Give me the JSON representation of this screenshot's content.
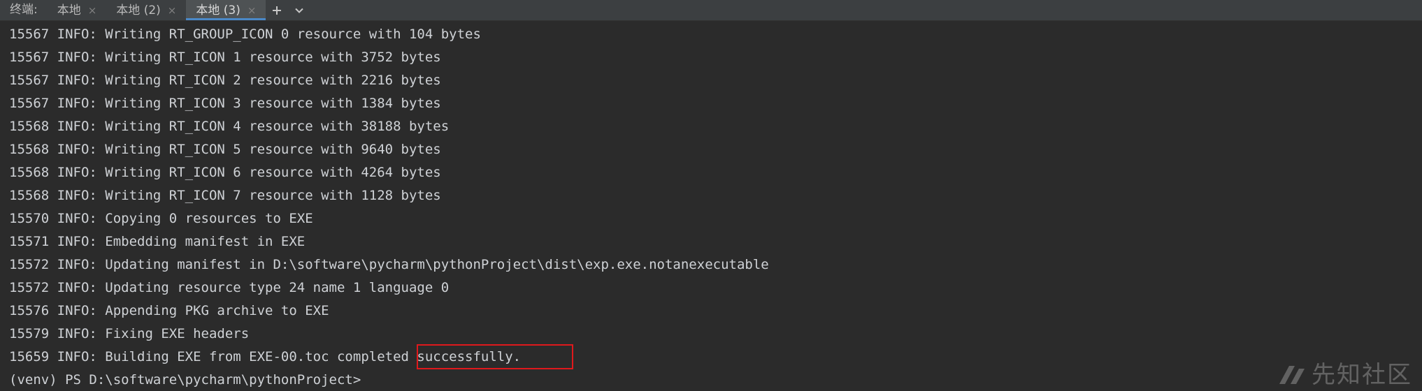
{
  "tabbar": {
    "caption": "终端:",
    "tabs": [
      {
        "label": "本地",
        "close": "×",
        "active": false
      },
      {
        "label": "本地 (2)",
        "close": "×",
        "active": false
      },
      {
        "label": "本地 (3)",
        "close": "×",
        "active": true
      }
    ],
    "add_icon": "plus-icon",
    "more_icon": "chevron-down-icon"
  },
  "terminal": {
    "lines": [
      "15567 INFO: Writing RT_GROUP_ICON 0 resource with 104 bytes",
      "15567 INFO: Writing RT_ICON 1 resource with 3752 bytes",
      "15567 INFO: Writing RT_ICON 2 resource with 2216 bytes",
      "15567 INFO: Writing RT_ICON 3 resource with 1384 bytes",
      "15568 INFO: Writing RT_ICON 4 resource with 38188 bytes",
      "15568 INFO: Writing RT_ICON 5 resource with 9640 bytes",
      "15568 INFO: Writing RT_ICON 6 resource with 4264 bytes",
      "15568 INFO: Writing RT_ICON 7 resource with 1128 bytes",
      "15570 INFO: Copying 0 resources to EXE",
      "15571 INFO: Embedding manifest in EXE",
      "15572 INFO: Updating manifest in D:\\software\\pycharm\\pythonProject\\dist\\exp.exe.notanexecutable",
      "15572 INFO: Updating resource type 24 name 1 language 0",
      "15576 INFO: Appending PKG archive to EXE",
      "15579 INFO: Fixing EXE headers",
      "15659 INFO: Building EXE from EXE-00.toc completed successfully.",
      "(venv) PS D:\\software\\pycharm\\pythonProject>"
    ]
  },
  "colors": {
    "background": "#2b2b2b",
    "tabbar": "#3c3f41",
    "text": "#cfd2d6",
    "accent": "#4a88c7",
    "highlight": "#e0191c"
  },
  "watermark": {
    "text": "先知社区"
  }
}
